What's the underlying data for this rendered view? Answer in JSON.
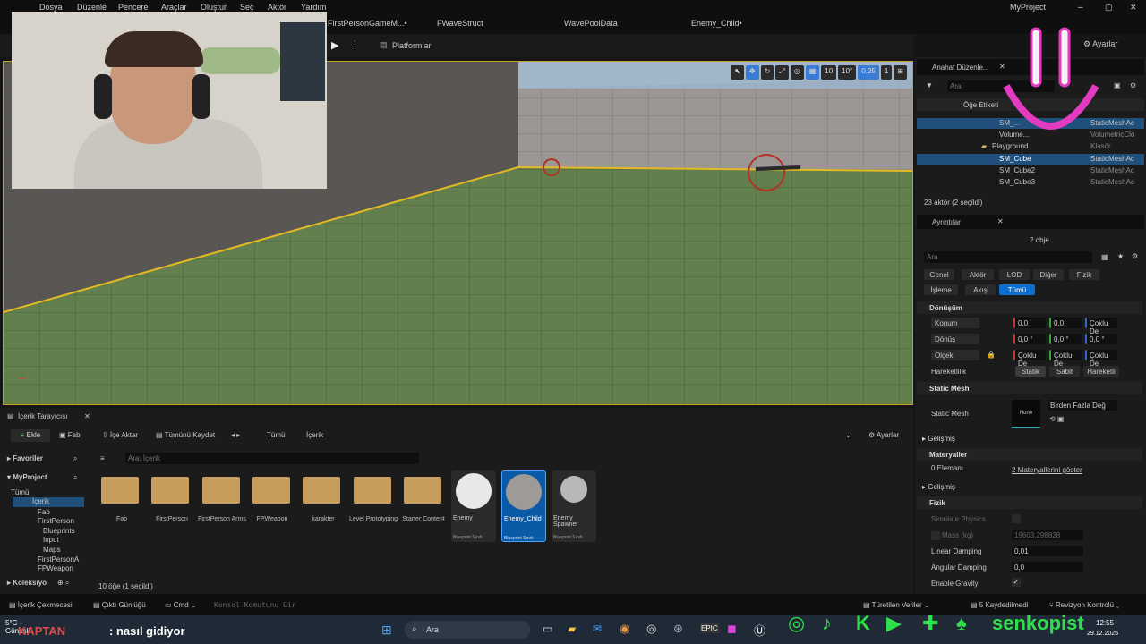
{
  "menu": [
    "Dosya",
    "Düzenle",
    "Pencere",
    "Araçlar",
    "Oluştur",
    "Seç",
    "Aktör",
    "Yardım"
  ],
  "window_title": "MyProject",
  "tabs": [
    "FirstPersonGameM...•",
    "FWaveStruct",
    "WavePoolData",
    "Enemy_Child•"
  ],
  "toolbar": {
    "platforms": "Platformlar",
    "settings": "Ayarlar"
  },
  "viewport": {
    "grid_size": "10",
    "rot_snap": "10°",
    "scale_snap": "0,25",
    "cam_speed": "1"
  },
  "outliner": {
    "title": "Anahat Düzenle...",
    "search_placeholder": "Ara",
    "col_label": "Öğe Etiketi",
    "rows": [
      {
        "name": "SM_...",
        "type": "StaticMeshAc"
      },
      {
        "name": "Volume...",
        "type": "VolumetricClo"
      },
      {
        "name": "Playground",
        "type": "Klasör"
      },
      {
        "name": "SM_Cube",
        "type": "StaticMeshAc"
      },
      {
        "name": "SM_Cube2",
        "type": "StaticMeshAc"
      },
      {
        "name": "SM_Cube3",
        "type": "StaticMeshAc"
      }
    ],
    "count": "23 aktör (2 seçildi)"
  },
  "details": {
    "title": "Ayrıntılar",
    "objects": "2 obje",
    "search_placeholder": "Ara",
    "filters1": [
      "Genel",
      "Aktör",
      "LOD",
      "Diğer",
      "Fizik"
    ],
    "filters2": [
      "İşleme",
      "Akış",
      "Tümü"
    ],
    "transform": "Dönüşüm",
    "location": "Konum",
    "rotation": "Dönüş",
    "scale": "Ölçek",
    "loc_vals": [
      "0,0",
      "0,0",
      "Çoklu De"
    ],
    "rot_vals": [
      "0,0 °",
      "0,0 °",
      "0,0 °"
    ],
    "scale_vals": [
      "Çoklu De",
      "Çoklu De",
      "Çoklu De"
    ],
    "mobility": "Hareketlilik",
    "mob_opts": [
      "Statik",
      "Sabit",
      "Hareketli"
    ],
    "static_mesh_sec": "Static Mesh",
    "static_mesh_lbl": "Static Mesh",
    "mesh_thumb": "None",
    "mesh_value": "Birden Fazla Değ",
    "advanced": "Gelişmiş",
    "materials": "Materyaller",
    "elements": "0 Elemanı",
    "show_materials": "2 Materyallerini göster",
    "physics": "Fizik",
    "simulate": "Simulate Physics",
    "mass": "Mass (kg)",
    "mass_val": "19603,298828",
    "lin_damp": "Linear Damping",
    "lin_val": "0,01",
    "ang_damp": "Angular Damping",
    "ang_val": "0,0",
    "gravity": "Enable Gravity"
  },
  "content": {
    "title": "İçerik Tarayıcısı",
    "add": "Ekle",
    "fab": "Fab",
    "import": "İçe Aktar",
    "save_all": "Tümünü Kaydet",
    "path": [
      "Tümü",
      "İçerik"
    ],
    "settings": "Ayarlar",
    "favorites": "Favoriler",
    "project": "MyProject",
    "search_placeholder": "Ara: İçerik",
    "collections": "Koleksiyo",
    "count": "10 öğe (1 seçildi)",
    "tree": [
      "Tümü",
      "İçerik",
      "Fab",
      "FirstPerson",
      "Blueprints",
      "Input",
      "Maps",
      "FirstPersonA",
      "FPWeapon"
    ],
    "folders": [
      "Fab",
      "FirstPerson",
      "FirstPerson Arms",
      "FPWeapon",
      "karakter",
      "Level Prototyping",
      "Starter Content"
    ],
    "assets": [
      {
        "name": "Enemy",
        "kind": "Blueprint Sınıfı"
      },
      {
        "name": "Enemy_Child",
        "kind": "Blueprint Sınıfı"
      },
      {
        "name": "Enemy Spawner",
        "kind": "Blueprint Sınıfı"
      }
    ]
  },
  "bottom": {
    "drawer": "İçerik Çekmecesi",
    "log": "Çıktı Günlüğü",
    "cmd": "Cmd",
    "console": "Konsol Komutunu Gir",
    "derived": "Türetilen Veriler",
    "saved": "5 Kaydedilmedi",
    "revision": "Revizyon Kontrolü"
  },
  "taskbar": {
    "weather": "5°C",
    "weather2": "Güneşli",
    "chat_user": "KAPTAN",
    "chat_msg": ": nasıl gidiyor",
    "search": "Ara",
    "time": "12:55",
    "date": "29.12.2025"
  },
  "overlay": {
    "brand": "senkopist"
  }
}
